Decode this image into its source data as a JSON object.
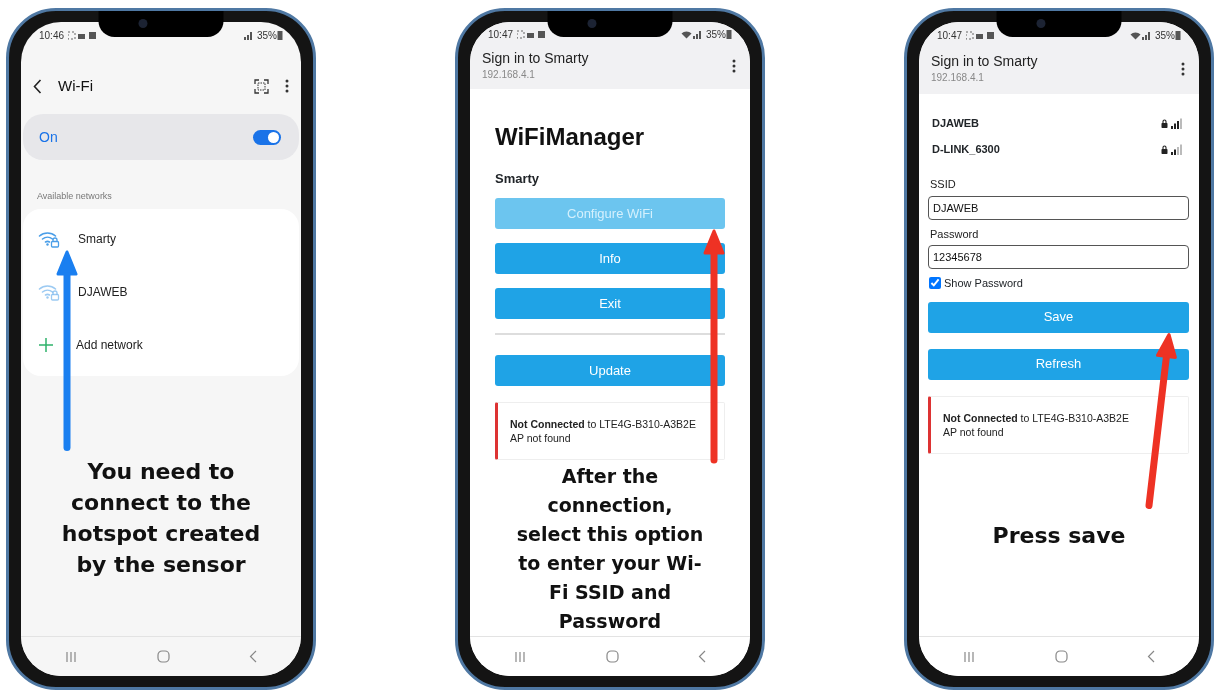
{
  "phones": [
    {
      "kind": "wifi_settings",
      "status_bar": {
        "time": "10:46",
        "wifi_connected": false,
        "battery": "35%"
      },
      "header": {
        "title": "Wi-Fi"
      },
      "wifi_toggle": {
        "label": "On",
        "on": true
      },
      "section_label": "Available networks",
      "networks": [
        {
          "name": "Smarty"
        },
        {
          "name": "DJAWEB"
        }
      ],
      "add_network": "Add network",
      "caption": "You need to connect to the hotspot created by the sensor",
      "arrow": {
        "color": "#1a7ff0"
      }
    },
    {
      "kind": "portal_menu",
      "status_bar": {
        "time": "10:47",
        "wifi_connected": true,
        "battery": "35%"
      },
      "app_bar": {
        "title": "Sign in to Smarty",
        "url": "192.168.4.1"
      },
      "heading": "WiFiManager",
      "device_name": "Smarty",
      "buttons": [
        {
          "label": "Configure WiFi",
          "disabled": true
        },
        {
          "label": "Info",
          "disabled": false
        },
        {
          "label": "Exit",
          "disabled": false
        }
      ],
      "update_button": {
        "label": "Update"
      },
      "status_message": {
        "text": "**Not Connected** to LTE4G-B310-A3B2E",
        "detail": "AP not found"
      },
      "caption": "After the connection, select this option to enter your Wi-Fi SSID and Password",
      "arrow": {
        "color": "#ee3224"
      }
    },
    {
      "kind": "portal_form",
      "status_bar": {
        "time": "10:47",
        "wifi_connected": true,
        "battery": "35%"
      },
      "app_bar": {
        "title": "Sign in to Smarty",
        "url": "192.168.4.1"
      },
      "networks": [
        {
          "name": "DJAWEB"
        },
        {
          "name": "D-LINK_6300"
        }
      ],
      "ssid": {
        "label": "SSID",
        "value": "DJAWEB"
      },
      "password": {
        "label": "Password",
        "value": "12345678"
      },
      "show_password": {
        "label": "Show Password",
        "checked": true
      },
      "buttons": [
        {
          "label": "Save"
        },
        {
          "label": "Refresh"
        }
      ],
      "status_message": {
        "text": "**Not Connected** to LTE4G-B310-A3B2E",
        "detail": "AP not found"
      },
      "caption": "Press save",
      "arrow": {
        "color": "#ee3224"
      }
    }
  ]
}
